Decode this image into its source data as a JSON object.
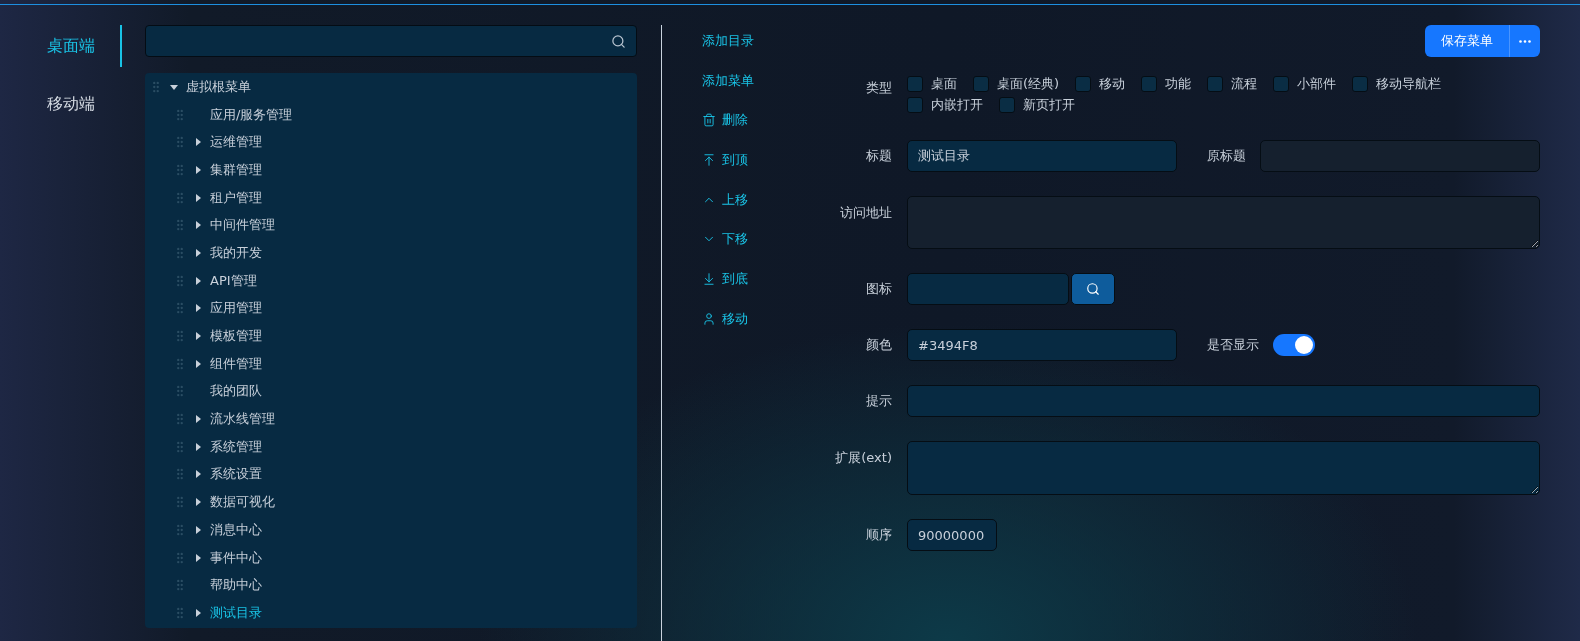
{
  "platform_tabs": [
    {
      "label": "桌面端",
      "selected": true
    },
    {
      "label": "移动端",
      "selected": false
    }
  ],
  "tree": {
    "label": "虚拟根菜单",
    "expanded": true,
    "selected": false,
    "children": [
      {
        "label": "应用/服务管理",
        "kind": "leaf",
        "selected": false
      },
      {
        "label": "运维管理",
        "kind": "folder",
        "expanded": false,
        "selected": false
      },
      {
        "label": "集群管理",
        "kind": "folder",
        "expanded": false,
        "selected": false
      },
      {
        "label": "租户管理",
        "kind": "folder",
        "expanded": false,
        "selected": false
      },
      {
        "label": "中间件管理",
        "kind": "folder",
        "expanded": false,
        "selected": false
      },
      {
        "label": "我的开发",
        "kind": "folder",
        "expanded": false,
        "selected": false
      },
      {
        "label": "API管理",
        "kind": "folder",
        "expanded": false,
        "selected": false
      },
      {
        "label": "应用管理",
        "kind": "folder",
        "expanded": false,
        "selected": false
      },
      {
        "label": "模板管理",
        "kind": "folder",
        "expanded": false,
        "selected": false
      },
      {
        "label": "组件管理",
        "kind": "folder",
        "expanded": false,
        "selected": false
      },
      {
        "label": "我的团队",
        "kind": "leaf",
        "selected": false
      },
      {
        "label": "流水线管理",
        "kind": "folder",
        "expanded": false,
        "selected": false
      },
      {
        "label": "系统管理",
        "kind": "folder",
        "expanded": false,
        "selected": false
      },
      {
        "label": "系统设置",
        "kind": "folder",
        "expanded": false,
        "selected": false
      },
      {
        "label": "数据可视化",
        "kind": "folder",
        "expanded": false,
        "selected": false
      },
      {
        "label": "消息中心",
        "kind": "folder",
        "expanded": false,
        "selected": false
      },
      {
        "label": "事件中心",
        "kind": "folder",
        "expanded": false,
        "selected": false
      },
      {
        "label": "帮助中心",
        "kind": "leaf",
        "selected": false
      },
      {
        "label": "测试目录",
        "kind": "folder",
        "expanded": false,
        "selected": true
      }
    ]
  },
  "actions": [
    {
      "label": "添加目录",
      "kind": "add"
    },
    {
      "label": "添加菜单",
      "kind": "add"
    },
    {
      "label": "删除",
      "kind": "delete"
    },
    {
      "label": "到顶",
      "kind": "top"
    },
    {
      "label": "上移",
      "kind": "up"
    },
    {
      "label": "下移",
      "kind": "down"
    },
    {
      "label": "到底",
      "kind": "bottom"
    },
    {
      "label": "移动",
      "kind": "move"
    }
  ],
  "save_button": {
    "label": "保存菜单"
  },
  "form": {
    "type_field": {
      "label": "类型",
      "options": [
        {
          "label": "桌面",
          "checked": false
        },
        {
          "label": "桌面(经典)",
          "checked": false
        },
        {
          "label": "移动",
          "checked": false
        },
        {
          "label": "功能",
          "checked": false
        },
        {
          "label": "流程",
          "checked": false
        },
        {
          "label": "小部件",
          "checked": false
        },
        {
          "label": "移动导航栏",
          "checked": false
        },
        {
          "label": "内嵌打开",
          "checked": false
        },
        {
          "label": "新页打开",
          "checked": false
        }
      ]
    },
    "title_field": {
      "label": "标题",
      "value": "测试目录"
    },
    "original_title_field": {
      "label": "原标题"
    },
    "url_field": {
      "label": "访问地址"
    },
    "icon_field": {
      "label": "图标"
    },
    "color_field": {
      "label": "颜色",
      "value": "#3494F8"
    },
    "visible_toggle": {
      "label": "是否显示",
      "on": true
    },
    "hint_field": {
      "label": "提示"
    },
    "ext_field": {
      "label": "扩展(ext)"
    },
    "order_field": {
      "label": "顺序",
      "value": "90000000"
    }
  }
}
